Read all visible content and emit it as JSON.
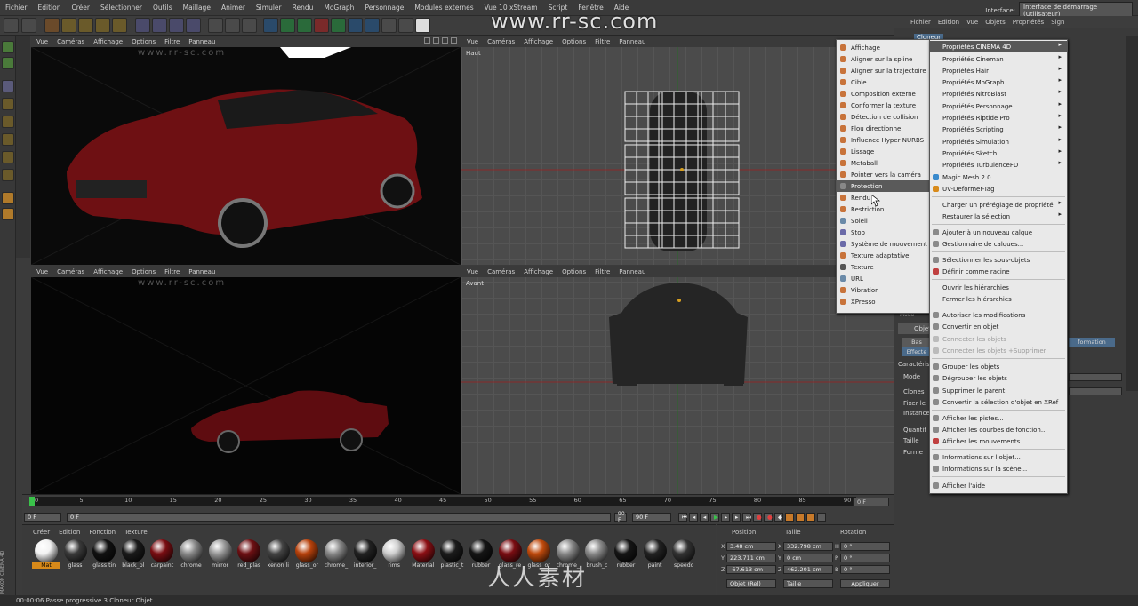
{
  "menubar": {
    "items": [
      "Fichier",
      "Edition",
      "Créer",
      "Sélectionner",
      "Outils",
      "Maillage",
      "Animer",
      "Simuler",
      "Rendu",
      "MoGraph",
      "Personnage",
      "Modules externes",
      "Vue 10 xStream",
      "Script",
      "Fenêtre",
      "Aide"
    ],
    "interface_label": "Interface:",
    "interface_value": "Interface de démarrage (Utilisateur)"
  },
  "watermark": {
    "top": "www.rr-sc.com",
    "small": "www.rr-sc.com",
    "logo": "人人素材"
  },
  "viewports": {
    "perspective": {
      "menu": [
        "Vue",
        "Caméras",
        "Affichage",
        "Options",
        "Filtre",
        "Panneau"
      ]
    },
    "top": {
      "menu": [
        "Vue",
        "Caméras",
        "Affichage",
        "Options",
        "Filtre",
        "Panneau"
      ],
      "label": "Haut"
    },
    "render": {
      "menu": [
        "Vue",
        "Caméras",
        "Affichage",
        "Options",
        "Filtre",
        "Panneau"
      ]
    },
    "front": {
      "menu": [
        "Vue",
        "Caméras",
        "Affichage",
        "Options",
        "Filtre",
        "Panneau"
      ],
      "label": "Avant"
    }
  },
  "tag_menu": {
    "items": [
      "Affichage",
      "Aligner sur la spline",
      "Aligner sur la trajectoire",
      "Cible",
      "Composition externe",
      "Conformer la texture",
      "Détection de collision",
      "Flou directionnel",
      "Influence Hyper NURBS",
      "Lissage",
      "Metaball",
      "Pointer vers la caméra",
      "Protection",
      "Rendu",
      "Restriction",
      "Soleil",
      "Stop",
      "Système de mouvement",
      "Texture adaptative",
      "Texture",
      "URL",
      "Vibration",
      "XPresso"
    ],
    "highlighted": "Protection"
  },
  "context_menu": {
    "header_menu": [
      "Fichier",
      "Edition",
      "Vue",
      "Objets",
      "Propriétés",
      "Sign"
    ],
    "sections": [
      [
        "Propriétés CINEMA 4D",
        "Propriétés Cineman",
        "Propriétés Hair",
        "Propriétés MoGraph",
        "Propriétés NitroBlast",
        "Propriétés Personnage",
        "Propriétés Riptide Pro",
        "Propriétés Scripting",
        "Propriétés Simulation",
        "Propriétés Sketch",
        "Propriétés TurbulenceFD",
        "Magic Mesh 2.0",
        "UV-Deformer-Tag"
      ],
      [
        "Charger un préréglage de propriété",
        "Restaurer la sélection"
      ],
      [
        "Ajouter à un nouveau calque",
        "Gestionnaire de calques..."
      ],
      [
        "Sélectionner les sous-objets",
        "Définir comme racine"
      ],
      [
        "Ouvrir les hiérarchies",
        "Fermer les hiérarchies"
      ],
      [
        "Autoriser les modifications",
        "Convertir en objet",
        "Connecter les objets",
        "Connecter les objets +Supprimer"
      ],
      [
        "Grouper les objets",
        "Dégrouper les objets",
        "Supprimer le parent",
        "Convertir la sélection d'objet en XRef"
      ],
      [
        "Afficher les pistes...",
        "Afficher les courbes de fonction...",
        "Afficher les mouvements"
      ],
      [
        "Informations sur l'objet...",
        "Informations sur la scène..."
      ],
      [
        "Afficher l'aide"
      ]
    ],
    "highlighted": "Propriétés CINEMA 4D",
    "disabled": [
      "Connecter les objets",
      "Connecter les objets +Supprimer"
    ]
  },
  "right_panel": {
    "object_name": "Cloneur",
    "attr_labels": [
      "Caractéris",
      "Mode",
      "Clones",
      "Fixer le",
      "Instance",
      "Quantit",
      "Taille",
      "Forme"
    ],
    "tabs": [
      "Bas",
      "Effecte"
    ],
    "info_tab": "formation",
    "obj_label": "Objet",
    "mode_label": "Mode"
  },
  "timeline": {
    "ticks": [
      "0",
      "5",
      "10",
      "15",
      "20",
      "25",
      "30",
      "35",
      "40",
      "45",
      "50",
      "55",
      "60",
      "65",
      "70",
      "75",
      "80",
      "85",
      "90"
    ],
    "start": "0 F",
    "current": "0 F",
    "end_field": "90 F",
    "end_field2": "90 F",
    "right_field": "0 F"
  },
  "material_manager": {
    "menu": [
      "Créer",
      "Edition",
      "Fonction",
      "Texture"
    ],
    "materials": [
      {
        "name": "Mat",
        "color": "#f2f2f2",
        "selected": true
      },
      {
        "name": "glass",
        "color": "#3a3a3a"
      },
      {
        "name": "glass tin",
        "color": "#111111"
      },
      {
        "name": "black_pl",
        "color": "#1a1a1a"
      },
      {
        "name": "carpaint",
        "color": "#7a0d12"
      },
      {
        "name": "chrome",
        "color": "#8a8a8a"
      },
      {
        "name": "mirror",
        "color": "#9a9a9a"
      },
      {
        "name": "red_plas",
        "color": "#6e1013"
      },
      {
        "name": "xenon li",
        "color": "#444444"
      },
      {
        "name": "glass_or",
        "color": "#b8420c"
      },
      {
        "name": "chrome_",
        "color": "#8a8a8a"
      },
      {
        "name": "interior_",
        "color": "#222222"
      },
      {
        "name": "rims",
        "color": "#cfcfcf"
      },
      {
        "name": "Material",
        "color": "#8c0f14"
      },
      {
        "name": "plastic_t",
        "color": "#1b1b1b"
      },
      {
        "name": "rubber",
        "color": "#151515"
      },
      {
        "name": "glass_re",
        "color": "#7a0d12"
      },
      {
        "name": "glass_or",
        "color": "#c04a0c"
      },
      {
        "name": "chrome_",
        "color": "#8a8a8a"
      },
      {
        "name": "brush_c",
        "color": "#8a8a8a"
      },
      {
        "name": "rubber",
        "color": "#151515"
      },
      {
        "name": "paint",
        "color": "#222222"
      },
      {
        "name": "speedo",
        "color": "#333333"
      }
    ]
  },
  "coordinates": {
    "headers": [
      "Position",
      "Taille",
      "Rotation"
    ],
    "rows": [
      {
        "axis": "X",
        "pos": "3.48 cm",
        "size_axis": "X",
        "size": "332.798 cm",
        "rot_axis": "H",
        "rot": "0 °"
      },
      {
        "axis": "Y",
        "pos": "223.711 cm",
        "size_axis": "Y",
        "size": "0 cm",
        "rot_axis": "P",
        "rot": "0 °"
      },
      {
        "axis": "Z",
        "pos": "-67.613 cm",
        "size_axis": "Z",
        "size": "462.201 cm",
        "rot_axis": "B",
        "rot": "0 °"
      }
    ],
    "mode_select": "Objet (Rel)",
    "size_select": "Taille",
    "apply": "Appliquer"
  },
  "status": {
    "text": "00:00:06 Passe progressive 3   Cloneur Objet"
  },
  "brand": {
    "maxon": "MAXON CINEMA 4D"
  },
  "colors": {
    "accent_orange": "#d88a1a",
    "menu_bg": "#e9e9e9",
    "highlight": "#575757",
    "car_red": "#8a1419"
  }
}
